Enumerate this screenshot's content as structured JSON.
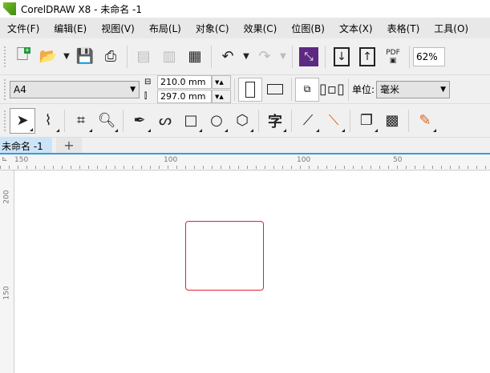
{
  "window": {
    "title": "CorelDRAW X8 - 未命名 -1"
  },
  "menu": [
    "文件(F)",
    "编辑(E)",
    "视图(V)",
    "布局(L)",
    "对象(C)",
    "效果(C)",
    "位图(B)",
    "文本(X)",
    "表格(T)",
    "工具(O)"
  ],
  "toolbar": {
    "zoom": "62%",
    "pdf_label": "PDF"
  },
  "property_bar": {
    "page_size": "A4",
    "width": "210.0 mm",
    "height": "297.0 mm",
    "units_label": "单位:",
    "units": "毫米"
  },
  "document_tabs": [
    {
      "label": "未命名 -1"
    }
  ],
  "rulers": {
    "horizontal": [
      "150",
      "100",
      "100",
      "50"
    ],
    "vertical": [
      "200",
      "150"
    ]
  },
  "colors": {
    "selection_rect": "#e0203a",
    "accent": "#5c2a82"
  }
}
